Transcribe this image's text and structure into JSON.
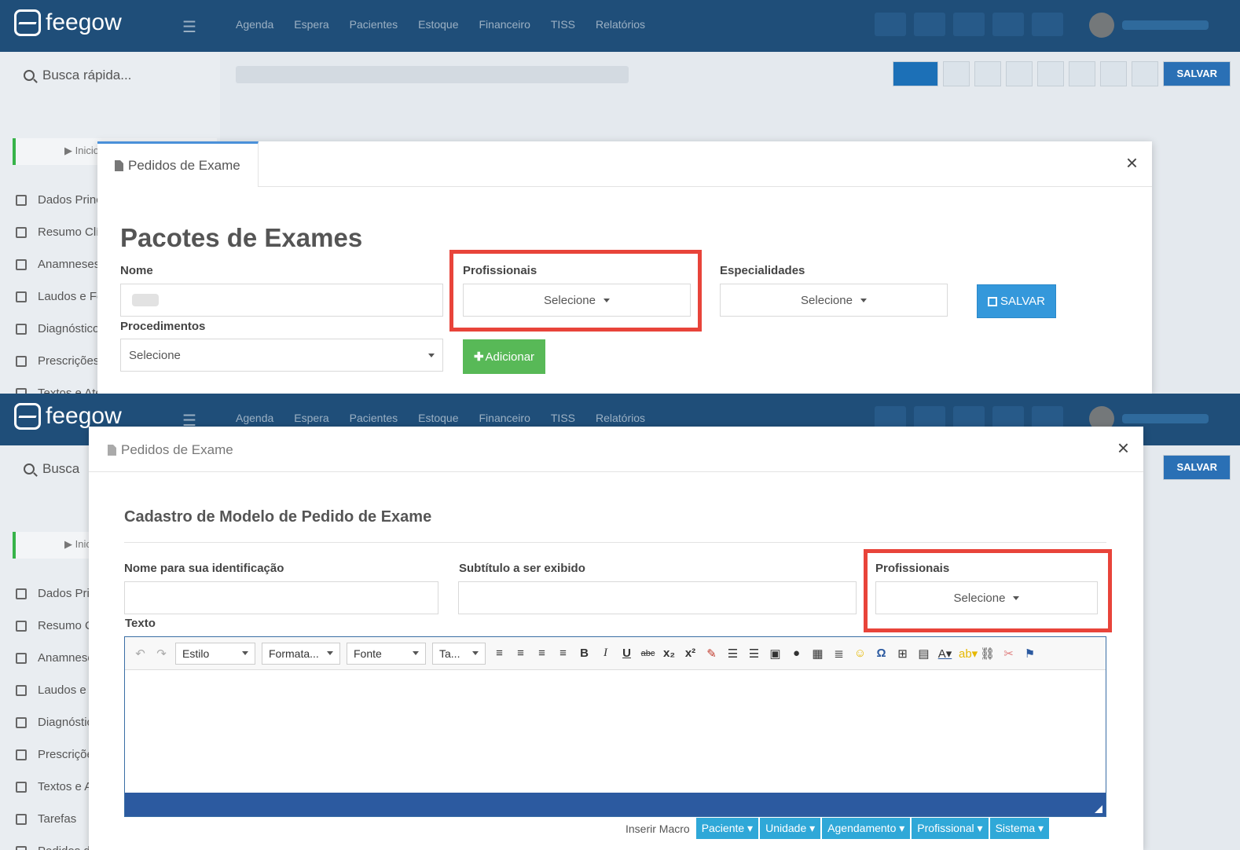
{
  "app": {
    "brand": "feegow",
    "nav": [
      "Agenda",
      "Espera",
      "Pacientes",
      "Estoque",
      "Financeiro",
      "TISS",
      "Relatórios"
    ],
    "search_label": "Busca rápida...",
    "search_label_short": "Busca",
    "sidebar_start": "Inicio",
    "sidebar_items": [
      "Dados Principais",
      "Resumo Clínico",
      "Anamneses",
      "Laudos e Formulários",
      "Diagnósticos",
      "Prescrições",
      "Textos e Atestados",
      "Tarefas",
      "Pedidos de Exame"
    ],
    "save_label": "SALVAR"
  },
  "modal_top": {
    "tab_label": "Pedidos de Exame",
    "close": "×",
    "heading": "Pacotes de Exames",
    "nome_label": "Nome",
    "profissionais_label": "Profissionais",
    "profissionais_value": "Selecione",
    "especialidades_label": "Especialidades",
    "especialidades_value": "Selecione",
    "save_button": "SALVAR",
    "procedimentos_label": "Procedimentos",
    "procedimentos_value": "Selecione",
    "add_button": "Adicionar"
  },
  "modal_bottom": {
    "tab_label": "Pedidos de Exame",
    "close": "×",
    "heading": "Cadastro de Modelo de Pedido de Exame",
    "nome_label": "Nome para sua identificação",
    "subtitulo_label": "Subtítulo a ser exibido",
    "profissionais_label": "Profissionais",
    "profissionais_value": "Selecione",
    "texto_label": "Texto",
    "toolbar": {
      "estilo": "Estilo",
      "formata": "Formata...",
      "fonte": "Fonte",
      "tamanho": "Ta..."
    },
    "macro_label": "Inserir Macro",
    "macros": [
      "Paciente",
      "Unidade",
      "Agendamento",
      "Profissional",
      "Sistema"
    ]
  },
  "colors": {
    "topbar": "#1f4e79",
    "highlight": "#e8443a",
    "save_blue": "#3498db",
    "add_green": "#58b957",
    "editor_footer": "#2c5aa0",
    "macro_button": "#2fa8d8"
  }
}
